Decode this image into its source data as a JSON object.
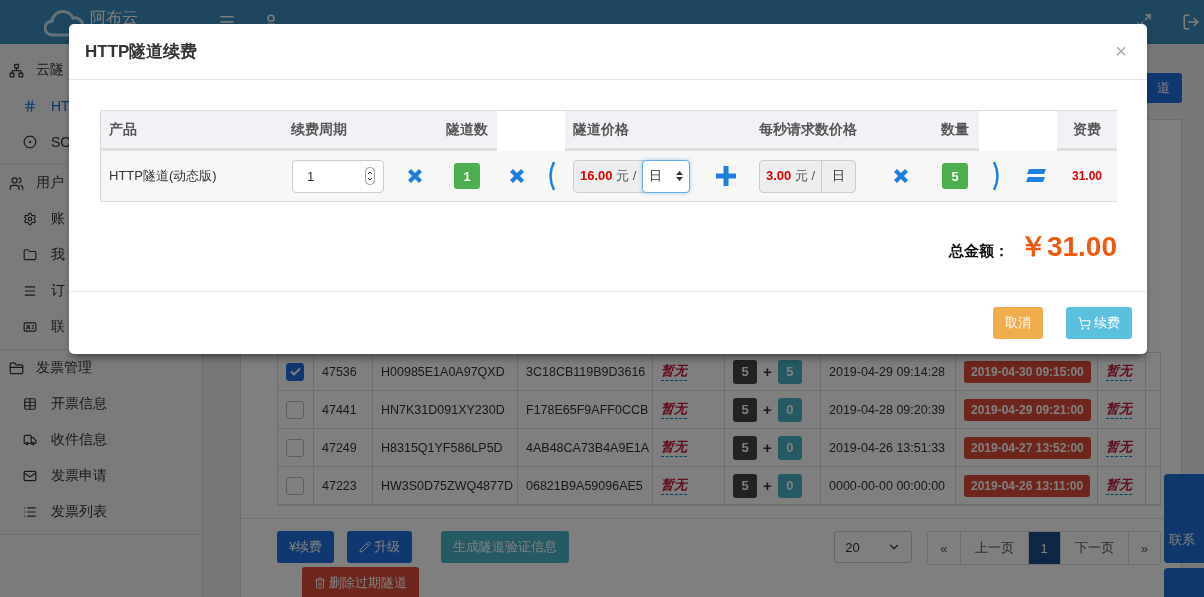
{
  "header": {
    "logo": "阿布云"
  },
  "toolbar": {
    "button": "道"
  },
  "sidebar": {
    "groups": [
      {
        "label": "云隧",
        "children": [
          {
            "label": "HT",
            "selected": true
          },
          {
            "label": "SO",
            "selected": false
          }
        ]
      },
      {
        "label": "用户",
        "children": [
          {
            "label": "账",
            "selected": false
          },
          {
            "label": "我",
            "selected": false
          },
          {
            "label": "订",
            "selected": false
          },
          {
            "label": "联",
            "selected": false
          }
        ]
      },
      {
        "label": "发票管理",
        "children": [
          {
            "label": "开票信息",
            "selected": false
          },
          {
            "label": "收件信息",
            "selected": false
          },
          {
            "label": "发票申请",
            "selected": false
          },
          {
            "label": "发票列表",
            "selected": false
          }
        ]
      }
    ]
  },
  "table": {
    "rows": [
      {
        "checked": true,
        "column_2": "47536",
        "column_3": "H00985E1A0A97QXD",
        "column_4": "3C18CB119B9D3616",
        "column_5": "暂无",
        "column_6": [
          "5",
          "+",
          "5"
        ],
        "column_7": "2019-04-29 09:14:28",
        "column_8": "2019-04-30 09:15:00",
        "column_9": "暂无"
      },
      {
        "checked": false,
        "column_2": "47441",
        "column_3": "HN7K31D091XY230D",
        "column_4": "F178E65F9AFF0CCB",
        "column_5": "暂无",
        "column_6": [
          "5",
          "+",
          "0"
        ],
        "column_7": "2019-04-28 09:20:39",
        "column_8": "2019-04-29 09:21:00",
        "column_9": "暂无"
      },
      {
        "checked": false,
        "column_2": "47249",
        "column_3": "H8315Q1YF586LP5D",
        "column_4": "4AB48CA73B4A9E1A",
        "column_5": "暂无",
        "column_6": [
          "5",
          "+",
          "0"
        ],
        "column_7": "2019-04-26 13:51:33",
        "column_8": "2019-04-27 13:52:00",
        "column_9": "暂无"
      },
      {
        "checked": false,
        "column_2": "47223",
        "column_3": "HW3S0D75ZWQ4877D",
        "column_4": "06821B9A59096AE5",
        "column_5": "暂无",
        "column_6": [
          "5",
          "+",
          "0"
        ],
        "column_7": "0000-00-00 00:00:00",
        "column_8": "2019-04-26 13:11:00",
        "column_9": "暂无"
      }
    ]
  },
  "actions": [
    {
      "label": "¥续费",
      "kind": "plain"
    },
    {
      "label": "升级",
      "kind": "edit"
    },
    {
      "label": "生成隧道验证信息",
      "kind": "info"
    },
    {
      "label": "删除过期隧道",
      "kind": "delete"
    }
  ],
  "page_size": "20",
  "pagination": [
    {
      "label": "«",
      "selected": false
    },
    {
      "label": "上一页",
      "selected": false
    },
    {
      "label": "1",
      "selected": true
    },
    {
      "label": "下一页",
      "selected": false
    },
    {
      "label": "»",
      "selected": false
    }
  ],
  "contact": {
    "label": "联系"
  },
  "modal": {
    "title": "HTTP隧道续费",
    "close": "×",
    "columns": [
      "产品",
      "续费周期",
      "隧道数",
      "隧道价格",
      "每秒请求数价格",
      "数量",
      "资费"
    ],
    "row": [
      {
        "kind": "text",
        "text": "HTTP隧道(动态版)"
      },
      {
        "kind": "spinner",
        "value": "1"
      },
      {
        "kind": "times"
      },
      {
        "kind": "badge",
        "text": "1"
      },
      {
        "kind": "times"
      },
      {
        "kind": "open_paren"
      },
      {
        "kind": "price_select",
        "amount": "16.00",
        "unit": "元 /",
        "period": "日"
      },
      {
        "kind": "plus"
      },
      {
        "kind": "price_fixed",
        "amount": "3.00",
        "unit": "元 /",
        "period": "日"
      },
      {
        "kind": "times"
      },
      {
        "kind": "badge",
        "text": "5"
      },
      {
        "kind": "close_paren"
      },
      {
        "kind": "equals"
      },
      {
        "kind": "total",
        "text": "31.00"
      }
    ],
    "total_label": "总金额：",
    "total_value": "￥31.00",
    "buttons": [
      {
        "label": "取消",
        "kind": "cancel"
      },
      {
        "label": "续费",
        "kind": "renew"
      }
    ]
  }
}
